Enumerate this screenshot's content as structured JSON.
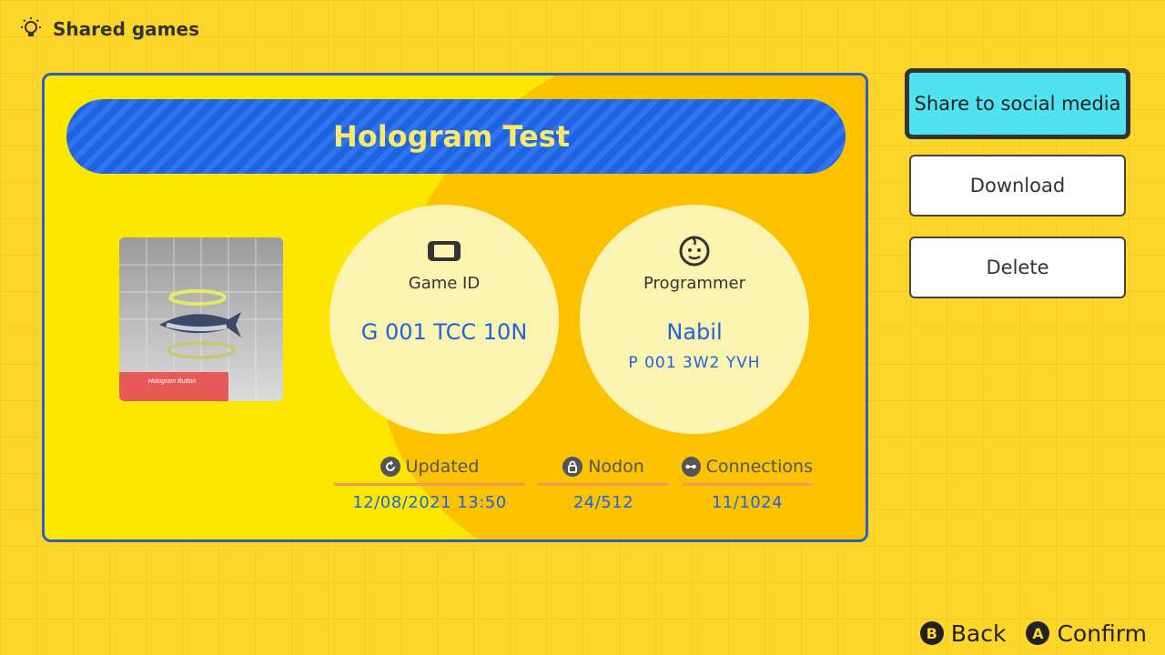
{
  "header": {
    "icon": "lightbulb-icon",
    "title": "Shared games"
  },
  "game": {
    "title": "Hologram Test",
    "thumbnail_caption": "Hologram Button",
    "game_id": {
      "icon": "console-icon",
      "label": "Game ID",
      "value": "G 001 TCC 10N"
    },
    "programmer": {
      "icon": "face-icon",
      "label": "Programmer",
      "name": "Nabil",
      "id": "P 001 3W2 YVH"
    },
    "stats": [
      {
        "icon": "refresh-icon",
        "label": "Updated",
        "value": "12/08/2021 13:50"
      },
      {
        "icon": "lock-icon",
        "label": "Nodon",
        "value": "24/512"
      },
      {
        "icon": "link-icon",
        "label": "Connections",
        "value": "11/1024"
      }
    ]
  },
  "actions": {
    "share": "Share to social media",
    "download": "Download",
    "delete": "Delete"
  },
  "footer": {
    "back": {
      "key": "B",
      "label": "Back"
    },
    "confirm": {
      "key": "A",
      "label": "Confirm"
    }
  },
  "colors": {
    "background": "#fdd62c",
    "accent_blue": "#1f63e0",
    "selected": "#4fe2ef"
  }
}
